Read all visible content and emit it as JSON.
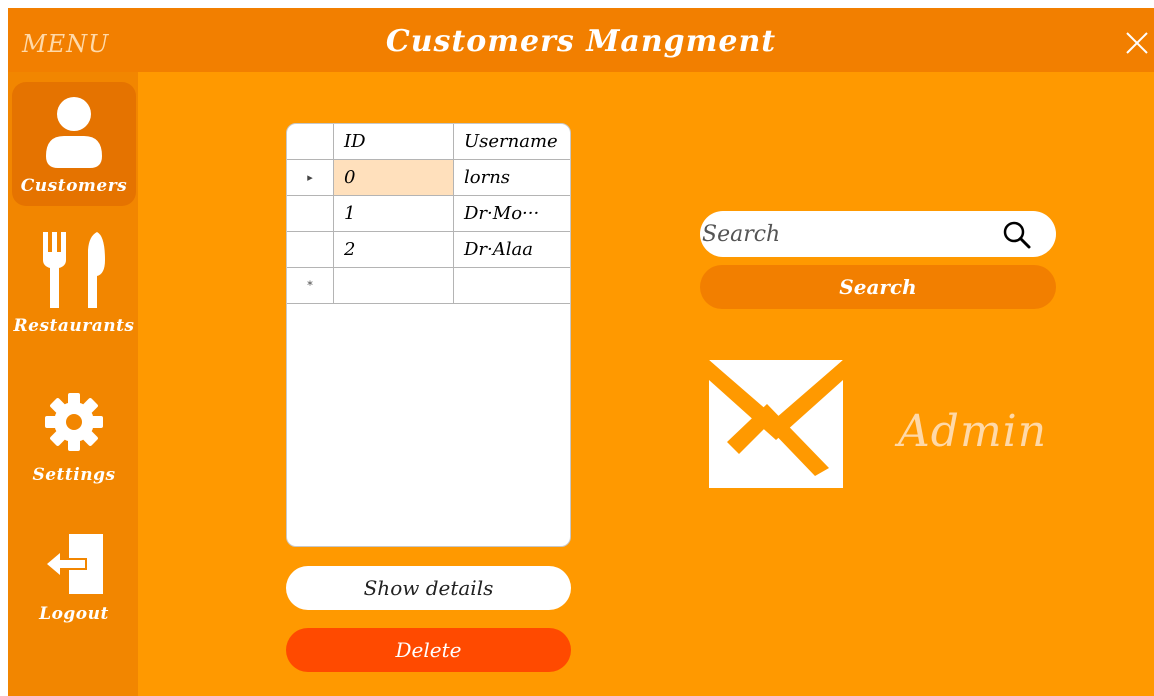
{
  "window": {
    "menu_label": "MENU",
    "title": "Customers Mangment"
  },
  "sidebar": {
    "items": [
      {
        "label": "Customers",
        "icon": "user-icon",
        "active": true
      },
      {
        "label": "Restaurants",
        "icon": "fork-knife-icon",
        "active": false
      },
      {
        "label": "Settings",
        "icon": "gear-icon",
        "active": false
      },
      {
        "label": "Logout",
        "icon": "logout-icon",
        "active": false
      }
    ]
  },
  "grid": {
    "columns": [
      "ID",
      "Username"
    ],
    "rows": [
      {
        "marker": "▸",
        "id": "0",
        "username": "lorns",
        "selected": true
      },
      {
        "marker": "",
        "id": "1",
        "username": "Dr·Mo···"
      },
      {
        "marker": "",
        "id": "2",
        "username": "Dr·Alaa"
      }
    ],
    "new_row_marker": "*"
  },
  "actions": {
    "show_details": "Show details",
    "delete": "Delete"
  },
  "search": {
    "placeholder": "Search",
    "button_label": "Search"
  },
  "user": {
    "role": "Admin"
  },
  "colors": {
    "background": "#FF9900",
    "titlebar": "#F27F00",
    "sidebar": "#F28600",
    "delete": "#FF4A00",
    "accent_text": "#FFD9A8"
  }
}
